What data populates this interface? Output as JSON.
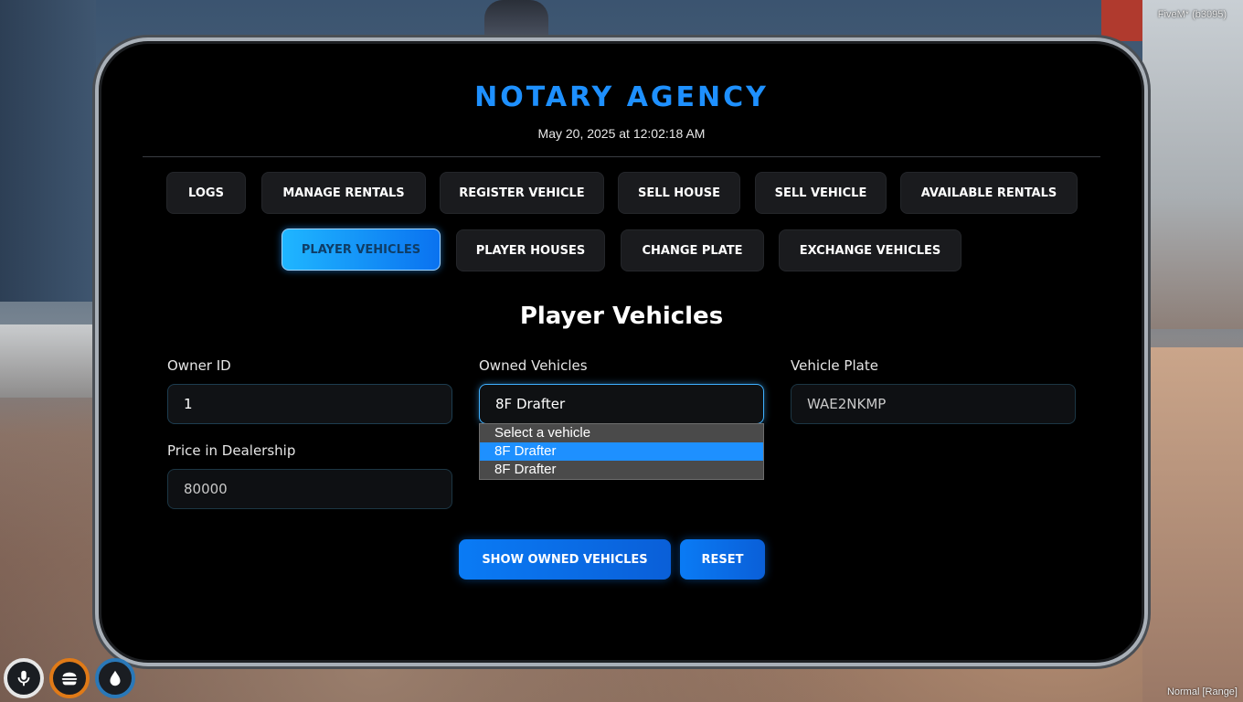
{
  "overlay": {
    "client_label": "FiveM* (b3095)",
    "voice_range": "Normal [Range]"
  },
  "header": {
    "title": "NOTARY AGENCY",
    "datetime": "May 20, 2025 at 12:02:18 AM"
  },
  "nav": {
    "row1": [
      "LOGS",
      "MANAGE RENTALS",
      "REGISTER VEHICLE",
      "SELL HOUSE",
      "SELL VEHICLE",
      "AVAILABLE RENTALS"
    ],
    "row2": [
      "PLAYER VEHICLES",
      "PLAYER HOUSES",
      "CHANGE PLATE",
      "EXCHANGE VEHICLES"
    ],
    "active": "PLAYER VEHICLES"
  },
  "section": {
    "title": "Player Vehicles"
  },
  "form": {
    "owner_id_label": "Owner ID",
    "owner_id_value": "1",
    "owned_vehicles_label": "Owned Vehicles",
    "owned_vehicles_value": "8F Drafter",
    "owned_vehicles_options": [
      "Select a vehicle",
      "8F Drafter",
      "8F Drafter"
    ],
    "owned_vehicles_highlighted_index": 1,
    "vehicle_plate_label": "Vehicle Plate",
    "vehicle_plate_value": "WAE2NKMP",
    "price_label": "Price in Dealership",
    "price_value": "80000"
  },
  "actions": {
    "show_owned_label": "SHOW OWNED VEHICLES",
    "reset_label": "RESET"
  },
  "hud": {
    "icons": [
      "microphone-icon",
      "burger-icon",
      "water-drop-icon"
    ],
    "colors": {
      "mic": "#e6e6e6",
      "food": "#e07a17",
      "water": "#2a78b8"
    }
  },
  "theme": {
    "accent": "#1e90ff",
    "panel_bg": "#000000",
    "button_bg": "#1a1b1e"
  }
}
